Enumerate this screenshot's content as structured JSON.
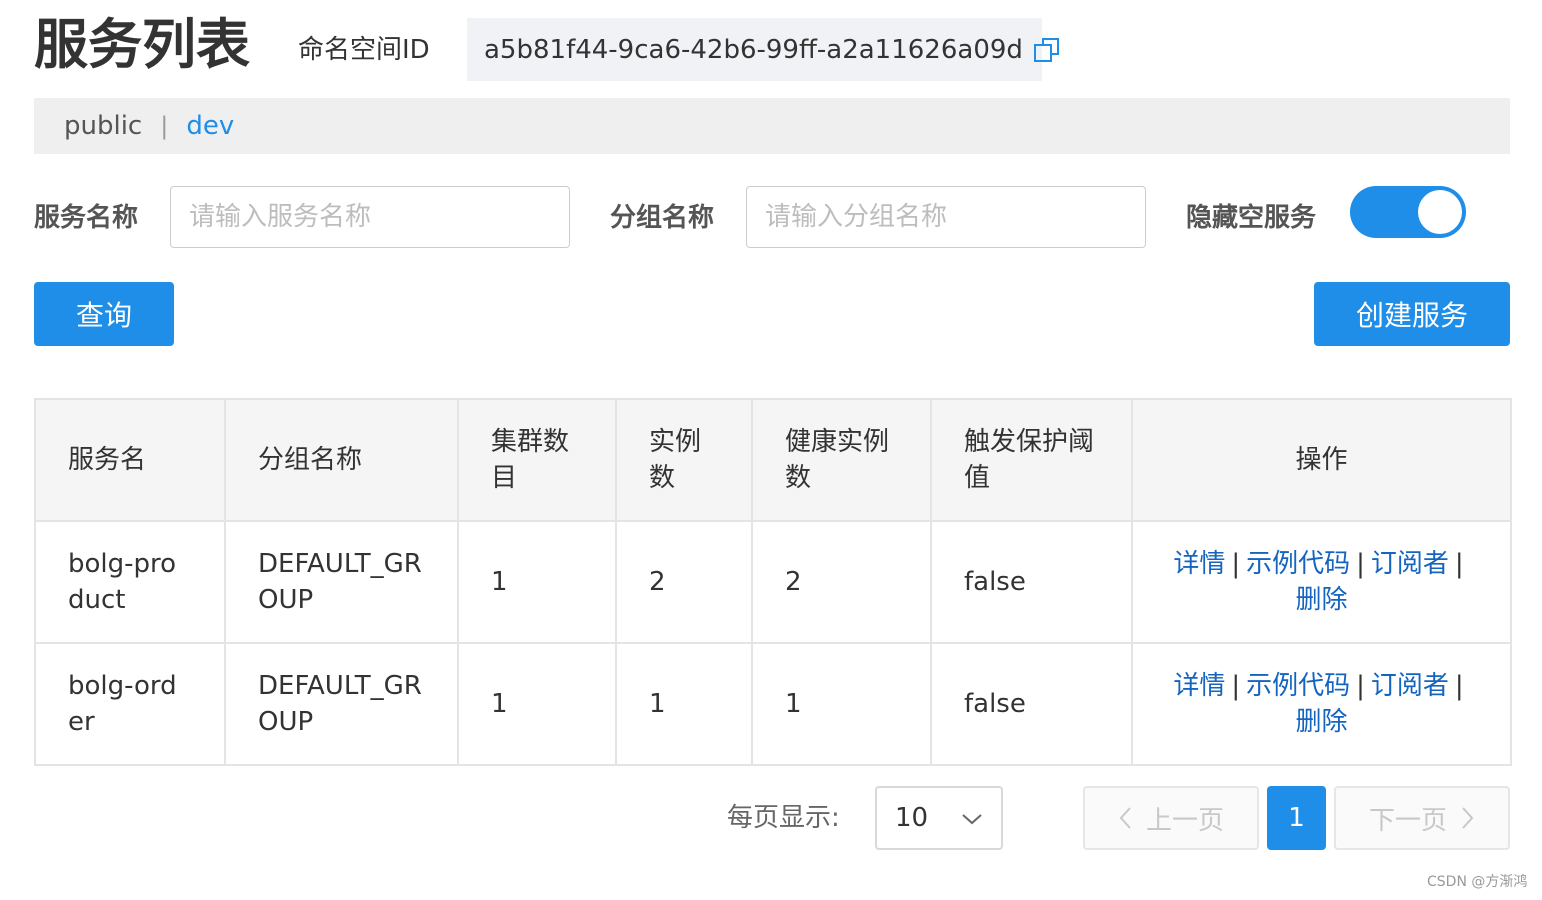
{
  "header": {
    "title": "服务列表",
    "namespace_label": "命名空间ID",
    "namespace_id": "a5b81f44-9ca6-42b6-99ff-a2a11626a09d",
    "copy_icon": "copy-icon"
  },
  "namespaces": {
    "items": [
      {
        "label": "public",
        "active": false
      },
      {
        "label": "dev",
        "active": true
      }
    ],
    "separator": "|"
  },
  "filters": {
    "service_name_label": "服务名称",
    "service_name_placeholder": "请输入服务名称",
    "service_name_value": "",
    "group_name_label": "分组名称",
    "group_name_placeholder": "请输入分组名称",
    "group_name_value": "",
    "hide_empty_label": "隐藏空服务",
    "hide_empty_on": true
  },
  "buttons": {
    "query": "查询",
    "create": "创建服务"
  },
  "table": {
    "headers": [
      "服务名",
      "分组名称",
      "集群数目",
      "实例数",
      "健康实例数",
      "触发保护阈值",
      "操作"
    ],
    "rows": [
      {
        "service": "bolg-product",
        "group": "DEFAULT_GROUP",
        "clusters": "1",
        "instances": "2",
        "healthy": "2",
        "threshold": "false"
      },
      {
        "service": "bolg-order",
        "group": "DEFAULT_GROUP",
        "clusters": "1",
        "instances": "1",
        "healthy": "1",
        "threshold": "false"
      }
    ],
    "actions": {
      "detail": "详情",
      "sample_code": "示例代码",
      "subscribers": "订阅者",
      "delete": "删除",
      "separator": "|"
    }
  },
  "pagination": {
    "page_size_label": "每页显示:",
    "page_size": "10",
    "prev": "上一页",
    "next": "下一页",
    "current_page": "1"
  },
  "watermark": "CSDN @方渐鸿",
  "colors": {
    "primary": "#1e8ee8",
    "link": "#1565c0"
  }
}
